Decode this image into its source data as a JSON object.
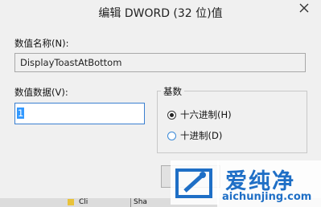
{
  "window": {
    "title": "编辑 DWORD (32 位)值",
    "close_glyph": "✕"
  },
  "form": {
    "name_label": "数值名称(N):",
    "name_value": "DisplayToastAtBottom",
    "data_label": "数值数据(V):",
    "data_value": "1",
    "base_group_title": "基数",
    "base_options": [
      {
        "label": "十六进制(H)",
        "checked": true
      },
      {
        "label": "十进制(D)",
        "checked": false
      }
    ]
  },
  "taskbar": {
    "items": [
      "Cli",
      "Sha"
    ]
  },
  "watermark": {
    "brand": "爱纯净",
    "url": "aichunjing.com"
  },
  "colors": {
    "accent_blue": "#3399ff",
    "watermark_blue": "#1f6fc6"
  }
}
